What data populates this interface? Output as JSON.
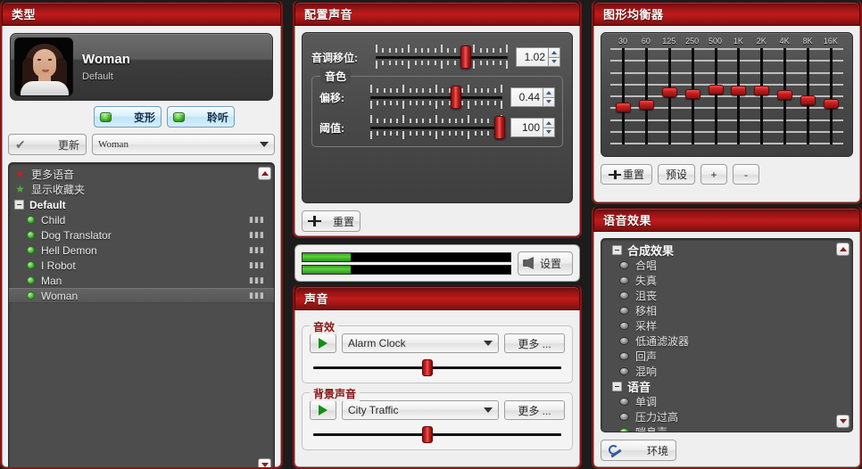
{
  "panels": {
    "type": {
      "title": "类型"
    },
    "configure_voice": {
      "title": "配置声音"
    },
    "sound": {
      "title": "声音"
    },
    "equalizer": {
      "title": "图形均衡器"
    },
    "voice_effects": {
      "title": "语音效果"
    }
  },
  "profile": {
    "name": "Woman",
    "subtitle": "Default",
    "avatar_icon": "woman-portrait",
    "morph_button": {
      "label": "变形",
      "led": "green"
    },
    "listen_button": {
      "label": "聆听",
      "led": "green"
    },
    "update_button": {
      "label": "更新",
      "icon": "check-icon"
    },
    "voice_select": {
      "value": "Woman"
    }
  },
  "voice_list": {
    "scroll_up_icon": "triangle-up-icon",
    "scroll_down_icon": "triangle-down-icon",
    "items": [
      {
        "label": "更多语音",
        "icon": "star-red-icon",
        "type": "link",
        "indent": 0
      },
      {
        "label": "显示收藏夹",
        "icon": "star-green-icon",
        "type": "link",
        "indent": 0
      },
      {
        "label": "Default",
        "icon": "minus-box-icon",
        "type": "group",
        "indent": 0
      },
      {
        "label": "Child",
        "icon": "green-dot-icon",
        "type": "voice",
        "indent": 1,
        "meter": true
      },
      {
        "label": "Dog Translator",
        "icon": "green-dot-icon",
        "type": "voice",
        "indent": 1,
        "meter": true
      },
      {
        "label": "Hell Demon",
        "icon": "green-dot-icon",
        "type": "voice",
        "indent": 1,
        "meter": true
      },
      {
        "label": "I Robot",
        "icon": "green-dot-icon",
        "type": "voice",
        "indent": 1,
        "meter": true
      },
      {
        "label": "Man",
        "icon": "green-dot-icon",
        "type": "voice",
        "indent": 1,
        "meter": true
      },
      {
        "label": "Woman",
        "icon": "green-dot-icon",
        "type": "voice",
        "indent": 1,
        "meter": true,
        "selected": true
      }
    ]
  },
  "configure_voice": {
    "pitch": {
      "label": "音调移位:",
      "value": "1.02",
      "knob_percent": 68
    },
    "timbre_group": {
      "label": "音色"
    },
    "shift": {
      "label": "偏移:",
      "value": "0.44",
      "knob_percent": 65
    },
    "threshold": {
      "label": "阈值:",
      "value": "100",
      "knob_percent": 98
    },
    "reset_button": {
      "label": "重置",
      "icon": "reset-icon"
    }
  },
  "meter_strip": {
    "meter_top_percent": 23,
    "meter_bottom_percent": 23,
    "settings_button": {
      "label": "设置",
      "icon": "speaker-icon"
    }
  },
  "sound": {
    "effects_group": {
      "label": "音效"
    },
    "effect": {
      "play_icon": "play-icon",
      "value": "Alarm Clock",
      "more_label": "更多 ...",
      "volume_percent": 46
    },
    "background_group": {
      "label": "背景声音"
    },
    "background": {
      "play_icon": "play-icon",
      "value": "City Traffic",
      "more_label": "更多 ...",
      "volume_percent": 46
    }
  },
  "equalizer": {
    "bands": [
      "30",
      "60",
      "125",
      "250",
      "500",
      "1K",
      "2K",
      "4K",
      "8K",
      "16K"
    ],
    "buttons": {
      "reset": {
        "label": "重置",
        "icon": "reset-icon"
      },
      "preset": {
        "label": "预设"
      },
      "plus": {
        "label": "+"
      },
      "minus": {
        "label": "-"
      }
    }
  },
  "chart_data": {
    "type": "bar",
    "title": "图形均衡器",
    "categories": [
      "30",
      "60",
      "125",
      "250",
      "500",
      "1K",
      "2K",
      "4K",
      "8K",
      "16K"
    ],
    "values": [
      -1,
      -0.8,
      0.4,
      0.2,
      0.6,
      0.5,
      0.5,
      0.1,
      -0.4,
      -0.7
    ],
    "xlabel": "",
    "ylabel": "",
    "ylim": [
      -4,
      4
    ],
    "grid": true,
    "legend": false
  },
  "voice_effects": {
    "scroll_up_icon": "triangle-up-icon",
    "scroll_down_icon": "triangle-down-icon",
    "items": [
      {
        "label": "合成效果",
        "type": "group",
        "icon": "minus-box-icon"
      },
      {
        "label": "合唱",
        "type": "effect",
        "icon": "knob-icon",
        "active": false
      },
      {
        "label": "失真",
        "type": "effect",
        "icon": "knob-icon",
        "active": false
      },
      {
        "label": "沮丧",
        "type": "effect",
        "icon": "knob-icon",
        "active": false
      },
      {
        "label": "移相",
        "type": "effect",
        "icon": "knob-icon",
        "active": false
      },
      {
        "label": "采样",
        "type": "effect",
        "icon": "knob-icon",
        "active": false
      },
      {
        "label": "低通滤波器",
        "type": "effect",
        "icon": "knob-icon",
        "active": false
      },
      {
        "label": "回声",
        "type": "effect",
        "icon": "knob-icon",
        "active": false
      },
      {
        "label": "混响",
        "type": "effect",
        "icon": "knob-icon",
        "active": false
      },
      {
        "label": "语音",
        "type": "group",
        "icon": "minus-box-icon"
      },
      {
        "label": "单调",
        "type": "effect",
        "icon": "knob-icon",
        "active": false
      },
      {
        "label": "压力过高",
        "type": "effect",
        "icon": "knob-icon",
        "active": false
      },
      {
        "label": "喘息声",
        "type": "effect",
        "icon": "knob-icon",
        "active": true
      }
    ],
    "environment_button": {
      "label": "环境",
      "icon": "wrench-icon"
    }
  }
}
